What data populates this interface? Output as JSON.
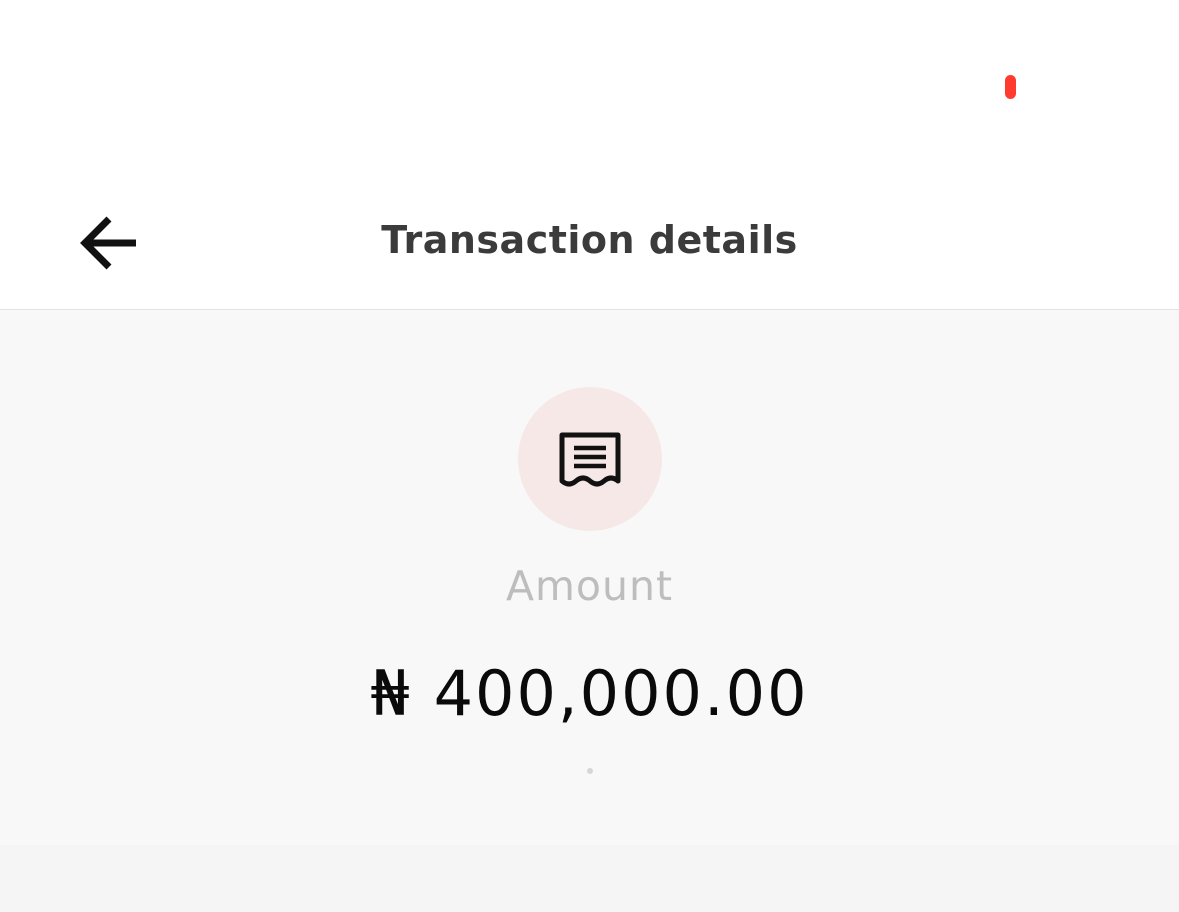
{
  "status_bar": {
    "indicator_color": "#ff3b30"
  },
  "header": {
    "title": "Transaction details",
    "back_icon": "arrow-left-icon"
  },
  "summary": {
    "icon": "receipt-icon",
    "icon_bg_color": "#f7e8e8",
    "amount_label": "Amount",
    "amount_value": "₦ 400,000.00"
  }
}
